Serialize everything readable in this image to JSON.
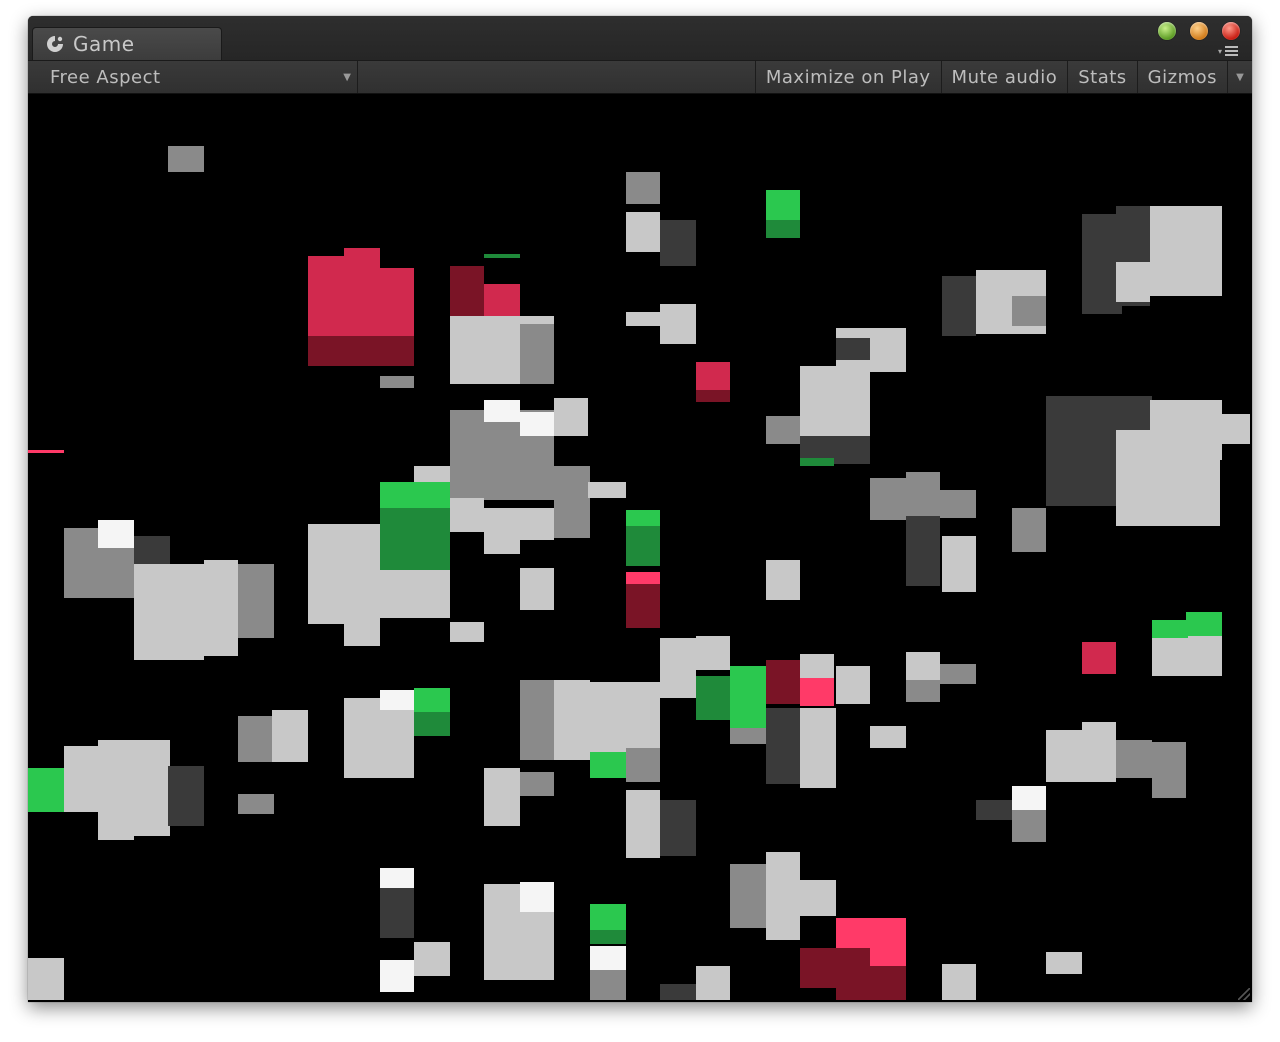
{
  "tab": {
    "title": "Game",
    "icon": "unity-game-icon"
  },
  "window_controls": [
    "green",
    "orange",
    "red"
  ],
  "toolbar": {
    "aspect_label": "Free Aspect",
    "maximize_label": "Maximize on Play",
    "mute_label": "Mute audio",
    "stats_label": "Stats",
    "gizmos_label": "Gizmos"
  },
  "colors": {
    "gray": "#c8c8c8",
    "gray_mid": "#8a8a8a",
    "gray_dark": "#3a3a3a",
    "white": "#f5f5f5",
    "green": "#2bc84f",
    "green_dark": "#1f8a3a",
    "red": "#d1294e",
    "red_dark": "#7a1426",
    "pink": "#ff3a68"
  }
}
